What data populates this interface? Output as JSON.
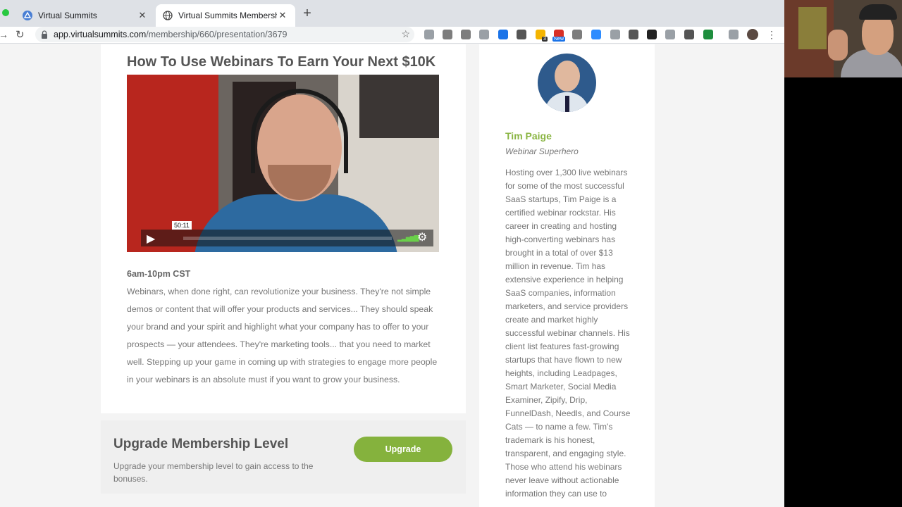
{
  "browser": {
    "tabs": [
      {
        "title": "Virtual Summits",
        "icon": "virtual-summits-favicon",
        "active": false
      },
      {
        "title": "Virtual Summits Membership",
        "icon": "globe-icon",
        "active": true
      }
    ],
    "url_host": "app.virtualsummits.com",
    "url_path": "/membership/660/presentation/3679",
    "extensions": [
      {
        "name": "code-ext-icon",
        "color": "#9aa0a6"
      },
      {
        "name": "dropbox-icon",
        "color": "#7d7d7d"
      },
      {
        "name": "w-ext-icon",
        "color": "#7d7d7d"
      },
      {
        "name": "b-ext-icon",
        "color": "#9aa0a6"
      },
      {
        "name": "blue-ext-icon",
        "color": "#1a73e8"
      },
      {
        "name": "circle-ext-icon",
        "color": "#555555"
      },
      {
        "name": "badge3-ext-icon",
        "color": "#f4b400"
      },
      {
        "name": "new-ext-icon",
        "color": "#d93025"
      },
      {
        "name": "w2-ext-icon",
        "color": "#7d7d7d"
      },
      {
        "name": "zoom-icon",
        "color": "#2d8cff"
      },
      {
        "name": "e-ext-icon",
        "color": "#9aa0a6"
      },
      {
        "name": "facebook-icon",
        "color": "#555555"
      },
      {
        "name": "buffer-icon",
        "color": "#222222"
      },
      {
        "name": "calendar-ext-icon",
        "color": "#9aa0a6"
      },
      {
        "name": "w3-ext-icon",
        "color": "#555555"
      },
      {
        "name": "search-ext-icon",
        "color": "#1e8e3e"
      },
      {
        "name": "playlist-ext-icon",
        "color": "#9aa0a6"
      },
      {
        "name": "profile-avatar",
        "color": "#5b4a42"
      },
      {
        "name": "menu-icon",
        "color": "#555555"
      }
    ],
    "badge_3": "3",
    "badge_new": "New"
  },
  "talk": {
    "title": "How To Use Webinars To Earn Your Next $10K",
    "video_time": "50:11",
    "schedule": "6am-10pm CST",
    "description": "Webinars, when done right, can revolutionize your business. They're not simple demos or content that will offer your products and services... They should speak your brand and your spirit and highlight what your company has to offer to your prospects — your attendees. They're marketing tools... that you need to market well. Stepping up your game in coming up with strategies to engage more people in your webinars is an absolute must if you want to grow your business."
  },
  "upgrade": {
    "title": "Upgrade Membership Level",
    "text": "Upgrade your membership level to gain access to the bonuses.",
    "button": "Upgrade",
    "button_color": "#85b23d"
  },
  "speaker": {
    "name": "Tim Paige",
    "role": "Webinar Superhero",
    "bio": "Hosting over 1,300 live webinars for some of the most successful SaaS startups, Tim Paige is a certified webinar rockstar. His career in creating and hosting high-converting webinars has brought in a total of over $13 million in revenue. Tim has extensive experience in helping SaaS companies, information marketers, and service providers create and market highly successful webinar channels. His client list features fast-growing startups that have flown to new heights, including Leadpages, Smart Marketer, Social Media Examiner, Zipify, Drip, FunnelDash, Needls, and Course Cats — to name a few. Tim's trademark is his honest, transparent, and engaging style. Those who attend his webinars never leave without actionable information they can use to"
  }
}
